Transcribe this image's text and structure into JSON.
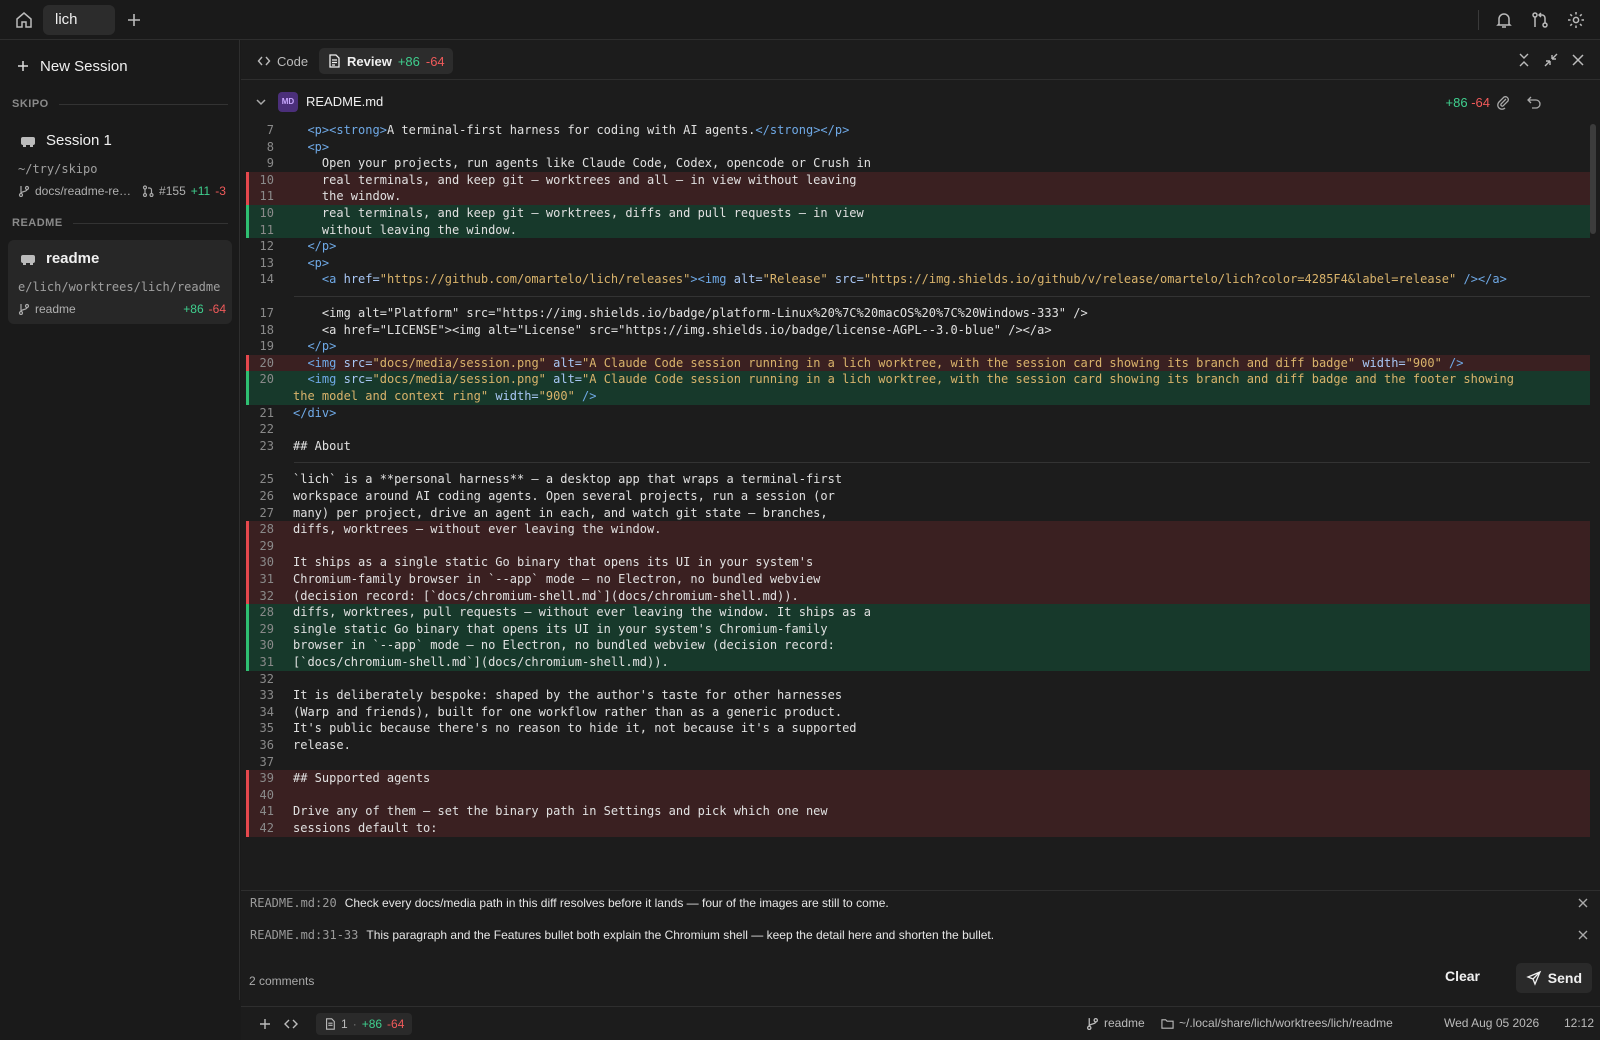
{
  "topbar": {
    "tab": "lich"
  },
  "sidebar": {
    "new_session": "New Session",
    "groups": [
      {
        "name": "SKIPO",
        "session": {
          "title": "Session 1",
          "path": "~/try/skipo",
          "branch": "docs/readme-re…",
          "pr": "#155",
          "add": "+11",
          "del": "-3"
        }
      },
      {
        "name": "README",
        "session": {
          "title": "readme",
          "path": "e/lich/worktrees/lich/readme",
          "branch": "readme",
          "add": "+86",
          "del": "-64"
        }
      }
    ]
  },
  "view_tabs": {
    "code": "Code",
    "review": "Review",
    "add": "+86",
    "del": "-64"
  },
  "file": {
    "badge": "MD",
    "name": "README.md",
    "add": "+86",
    "del": "-64"
  },
  "lines": [
    {
      "n": "7",
      "k": "ctx",
      "h": "  <span class=\"tg\">&lt;p&gt;&lt;strong&gt;</span>A terminal-first harness for coding with AI agents.<span class=\"tg\">&lt;/strong&gt;&lt;/p&gt;</span>"
    },
    {
      "n": "8",
      "k": "ctx",
      "h": "  <span class=\"tg\">&lt;p&gt;</span>"
    },
    {
      "n": "9",
      "k": "ctx",
      "h": "    Open your projects, run agents like Claude Code, Codex, opencode or Crush in"
    },
    {
      "n": "10",
      "k": "del",
      "h": "    real terminals, and keep git — worktrees and all — in view without leaving"
    },
    {
      "n": "11",
      "k": "del",
      "h": "    the window."
    },
    {
      "n": "10",
      "k": "add",
      "h": "    real terminals, and keep git — worktrees, diffs and pull requests — in view"
    },
    {
      "n": "11",
      "k": "add",
      "h": "    without leaving the window."
    },
    {
      "n": "12",
      "k": "ctx",
      "h": "  <span class=\"tg\">&lt;/p&gt;</span>"
    },
    {
      "n": "13",
      "k": "ctx",
      "h": "  <span class=\"tg\">&lt;p&gt;</span>"
    },
    {
      "n": "14",
      "k": "ctx",
      "h": "    <span class=\"tg\">&lt;a</span> <span class=\"at\">href=</span><span class=\"st\">\"https://github.com/omartelo/lich/releases\"</span><span class=\"tg\">&gt;&lt;img</span> <span class=\"at\">alt=</span><span class=\"st\">\"Release\"</span> <span class=\"at\">src=</span><span class=\"st\">\"https://img.shields.io/github/v/release/omartelo/lich?color=4285F4&amp;label=release\"</span> <span class=\"tg\">/&gt;&lt;/a&gt;</span>"
    },
    {
      "n": "",
      "k": "gap",
      "h": ""
    },
    {
      "n": "17",
      "k": "ctx",
      "h": "    &lt;img alt=\"Platform\" src=\"https://img.shields.io/badge/platform-Linux%20%7C%20macOS%20%7C%20Windows-333\" /&gt;"
    },
    {
      "n": "18",
      "k": "ctx",
      "h": "    &lt;a href=\"LICENSE\"&gt;&lt;img alt=\"License\" src=\"https://img.shields.io/badge/license-AGPL--3.0-blue\" /&gt;&lt;/a&gt;"
    },
    {
      "n": "19",
      "k": "ctx",
      "h": "  <span class=\"tg\">&lt;/p&gt;</span>"
    },
    {
      "n": "20",
      "k": "del",
      "h": "  <span class=\"tg\">&lt;img</span> <span class=\"at\">src=</span><span class=\"st\">\"docs/media/session.png\"</span> <span class=\"at\">alt=</span><span class=\"st\">\"A Claude Code session running in a lich worktree, with the session card showing its branch and diff badge\"</span> <span class=\"at\">width=</span><span class=\"st\">\"900\"</span> <span class=\"tg\">/&gt;</span>"
    },
    {
      "n": "20",
      "k": "add",
      "h": "  <span class=\"tg\">&lt;img</span> <span class=\"at\">src=</span><span class=\"st\">\"docs/media/session.png\"</span> <span class=\"at\">alt=</span><span class=\"st\">\"A Claude Code session running in a lich worktree, with the session card showing its branch and diff badge and the footer showing</span>"
    },
    {
      "n": "",
      "k": "add",
      "h": "<span class=\"st\">the model and context ring\"</span> <span class=\"at\">width=</span><span class=\"st\">\"900\"</span> <span class=\"tg\">/&gt;</span>"
    },
    {
      "n": "21",
      "k": "ctx",
      "h": "<span class=\"tg\">&lt;/div&gt;</span>"
    },
    {
      "n": "22",
      "k": "ctx",
      "h": ""
    },
    {
      "n": "23",
      "k": "ctx",
      "h": "## About"
    },
    {
      "n": "",
      "k": "gap",
      "h": ""
    },
    {
      "n": "25",
      "k": "ctx",
      "h": "`lich` is a **personal harness** — a desktop app that wraps a terminal-first"
    },
    {
      "n": "26",
      "k": "ctx",
      "h": "workspace around AI coding agents. Open several projects, run a session (or"
    },
    {
      "n": "27",
      "k": "ctx",
      "h": "many) per project, drive an agent in each, and watch git state — branches,"
    },
    {
      "n": "28",
      "k": "del",
      "h": "diffs, worktrees — without ever leaving the window."
    },
    {
      "n": "29",
      "k": "del",
      "h": ""
    },
    {
      "n": "30",
      "k": "del",
      "h": "It ships as a single static Go binary that opens its UI in your system's"
    },
    {
      "n": "31",
      "k": "del",
      "h": "Chromium-family browser in `--app` mode — no Electron, no bundled webview"
    },
    {
      "n": "32",
      "k": "del",
      "h": "(decision record: [`docs/chromium-shell.md`](docs/chromium-shell.md))."
    },
    {
      "n": "28",
      "k": "add",
      "h": "diffs, worktrees, pull requests — without ever leaving the window. It ships as a"
    },
    {
      "n": "29",
      "k": "add",
      "h": "single static Go binary that opens its UI in your system's Chromium-family"
    },
    {
      "n": "30",
      "k": "add",
      "h": "browser in `--app` mode — no Electron, no bundled webview (decision record:"
    },
    {
      "n": "31",
      "k": "add",
      "h": "[`docs/chromium-shell.md`](docs/chromium-shell.md))."
    },
    {
      "n": "32",
      "k": "ctx",
      "h": ""
    },
    {
      "n": "33",
      "k": "ctx",
      "h": "It is deliberately bespoke: shaped by the author's taste for other harnesses"
    },
    {
      "n": "34",
      "k": "ctx",
      "h": "(Warp and friends), built for one workflow rather than as a generic product."
    },
    {
      "n": "35",
      "k": "ctx",
      "h": "It's public because there's no reason to hide it, not because it's a supported"
    },
    {
      "n": "36",
      "k": "ctx",
      "h": "release."
    },
    {
      "n": "37",
      "k": "ctx",
      "h": ""
    },
    {
      "n": "39",
      "k": "del",
      "h": "## Supported agents"
    },
    {
      "n": "40",
      "k": "del",
      "h": ""
    },
    {
      "n": "41",
      "k": "del",
      "h": "Drive any of them — set the binary path in Settings and pick which one new"
    },
    {
      "n": "42",
      "k": "del",
      "h": "sessions default to:"
    }
  ],
  "comments": [
    {
      "ref": "README.md:20",
      "text": "Check every docs/media path in this diff resolves before it lands — four of the images are still to come."
    },
    {
      "ref": "README.md:31-33",
      "text": "This paragraph and the Features bullet both explain the Chromium shell — keep the detail here and shorten the bullet."
    }
  ],
  "comment_bar": {
    "count": "2 comments",
    "clear": "Clear",
    "send": "Send"
  },
  "statusbar": {
    "count": "1",
    "dot": "·",
    "add": "+86",
    "del": "-64",
    "branch": "readme",
    "path": "~/.local/share/lich/worktrees/lich/readme",
    "date": "Wed Aug 05 2026",
    "time": "12:12"
  },
  "colors": {
    "add": "#3fcf8e",
    "del": "#f05a5a",
    "add_bg": "#17392b",
    "del_bg": "#3a2021"
  }
}
